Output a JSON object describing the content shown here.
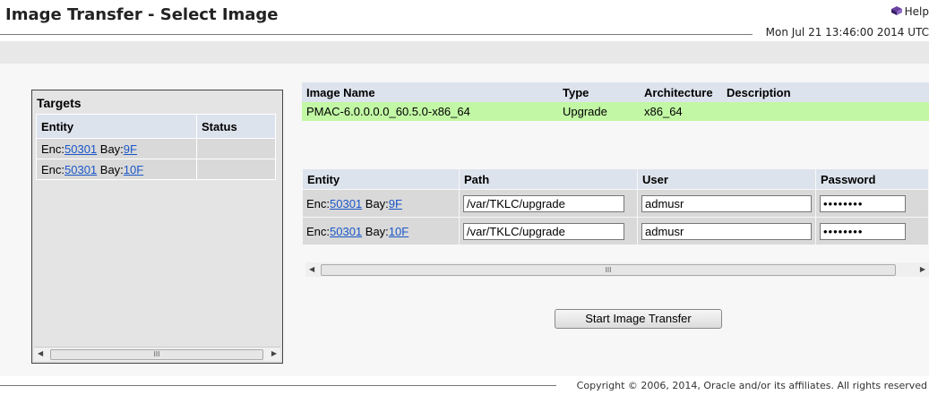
{
  "page": {
    "title": "Image Transfer - Select Image",
    "help_label": "Help",
    "datetime": "Mon Jul 21 13:46:00 2014 UTC",
    "copyright": "Copyright © 2006, 2014, Oracle and/or its affiliates. All rights reserved"
  },
  "targets": {
    "title": "Targets",
    "headers": [
      "Entity",
      "Status"
    ],
    "rows": [
      {
        "enc_label": "Enc:",
        "enc": "50301",
        "bay_label": " Bay:",
        "bay": "9F",
        "status": ""
      },
      {
        "enc_label": "Enc:",
        "enc": "50301",
        "bay_label": " Bay:",
        "bay": "10F",
        "status": ""
      }
    ]
  },
  "image_table": {
    "headers": [
      "Image Name",
      "Type",
      "Architecture",
      "Description"
    ],
    "row": {
      "name": "PMAC-6.0.0.0.0_60.5.0-x86_64",
      "type": "Upgrade",
      "arch": "x86_64",
      "description": ""
    }
  },
  "path_table": {
    "headers": [
      "Entity",
      "Path",
      "User",
      "Password"
    ],
    "rows": [
      {
        "enc_label": "Enc:",
        "enc": "50301",
        "bay_label": " Bay:",
        "bay": "9F",
        "path": "/var/TKLC/upgrade",
        "user": "admusr",
        "password": "••••••••"
      },
      {
        "enc_label": "Enc:",
        "enc": "50301",
        "bay_label": " Bay:",
        "bay": "10F",
        "path": "/var/TKLC/upgrade",
        "user": "admusr",
        "password": "••••••••"
      }
    ]
  },
  "actions": {
    "start_label": "Start Image Transfer"
  },
  "scrollbar": {
    "grip": "III",
    "left_arrow": "◀",
    "right_arrow": "▶"
  },
  "colors": {
    "header_bg": "#dde3ec",
    "selected_row": "#c2f7a5",
    "link": "#1a56c8"
  }
}
